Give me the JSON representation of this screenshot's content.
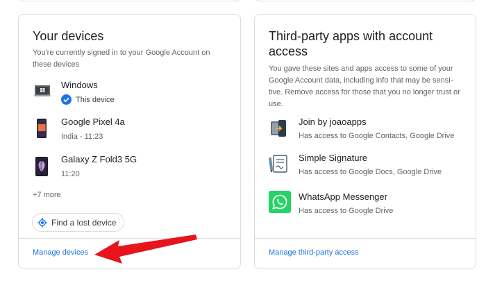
{
  "devices_card": {
    "title": "Your devices",
    "description": "You're currently signed in to your Google Account on these devices",
    "devices": [
      {
        "name": "Windows",
        "detail": "This device",
        "icon": "laptop-icon"
      },
      {
        "name": "Google Pixel 4a",
        "detail": "India - 11:23",
        "icon": "phone-icon"
      },
      {
        "name": "Galaxy Z Fold3 5G",
        "detail": "11:20",
        "icon": "foldable-phone-icon"
      }
    ],
    "more": "+7 more",
    "find_button": "Find a lost device",
    "footer_link": "Manage devices"
  },
  "apps_card": {
    "title": "Third-party apps with account access",
    "description": "You gave these sites and apps access to some of your Google Account data, including info that may be sensi-tive. Remove access for those that you no longer trust or use.",
    "apps": [
      {
        "name": "Join by joaoapps",
        "access": "Has access to Google Contacts, Google Drive",
        "icon": "join-app-icon"
      },
      {
        "name": "Simple Signature",
        "access": "Has access to Google Docs, Google Drive",
        "icon": "signature-app-icon"
      },
      {
        "name": "WhatsApp Messenger",
        "access": "Has access to Google Drive",
        "icon": "whatsapp-icon"
      }
    ],
    "footer_link": "Manage third-party access"
  },
  "colors": {
    "accent": "#1a73e8",
    "annotation_arrow": "#e8141b",
    "whatsapp": "#25d366"
  }
}
